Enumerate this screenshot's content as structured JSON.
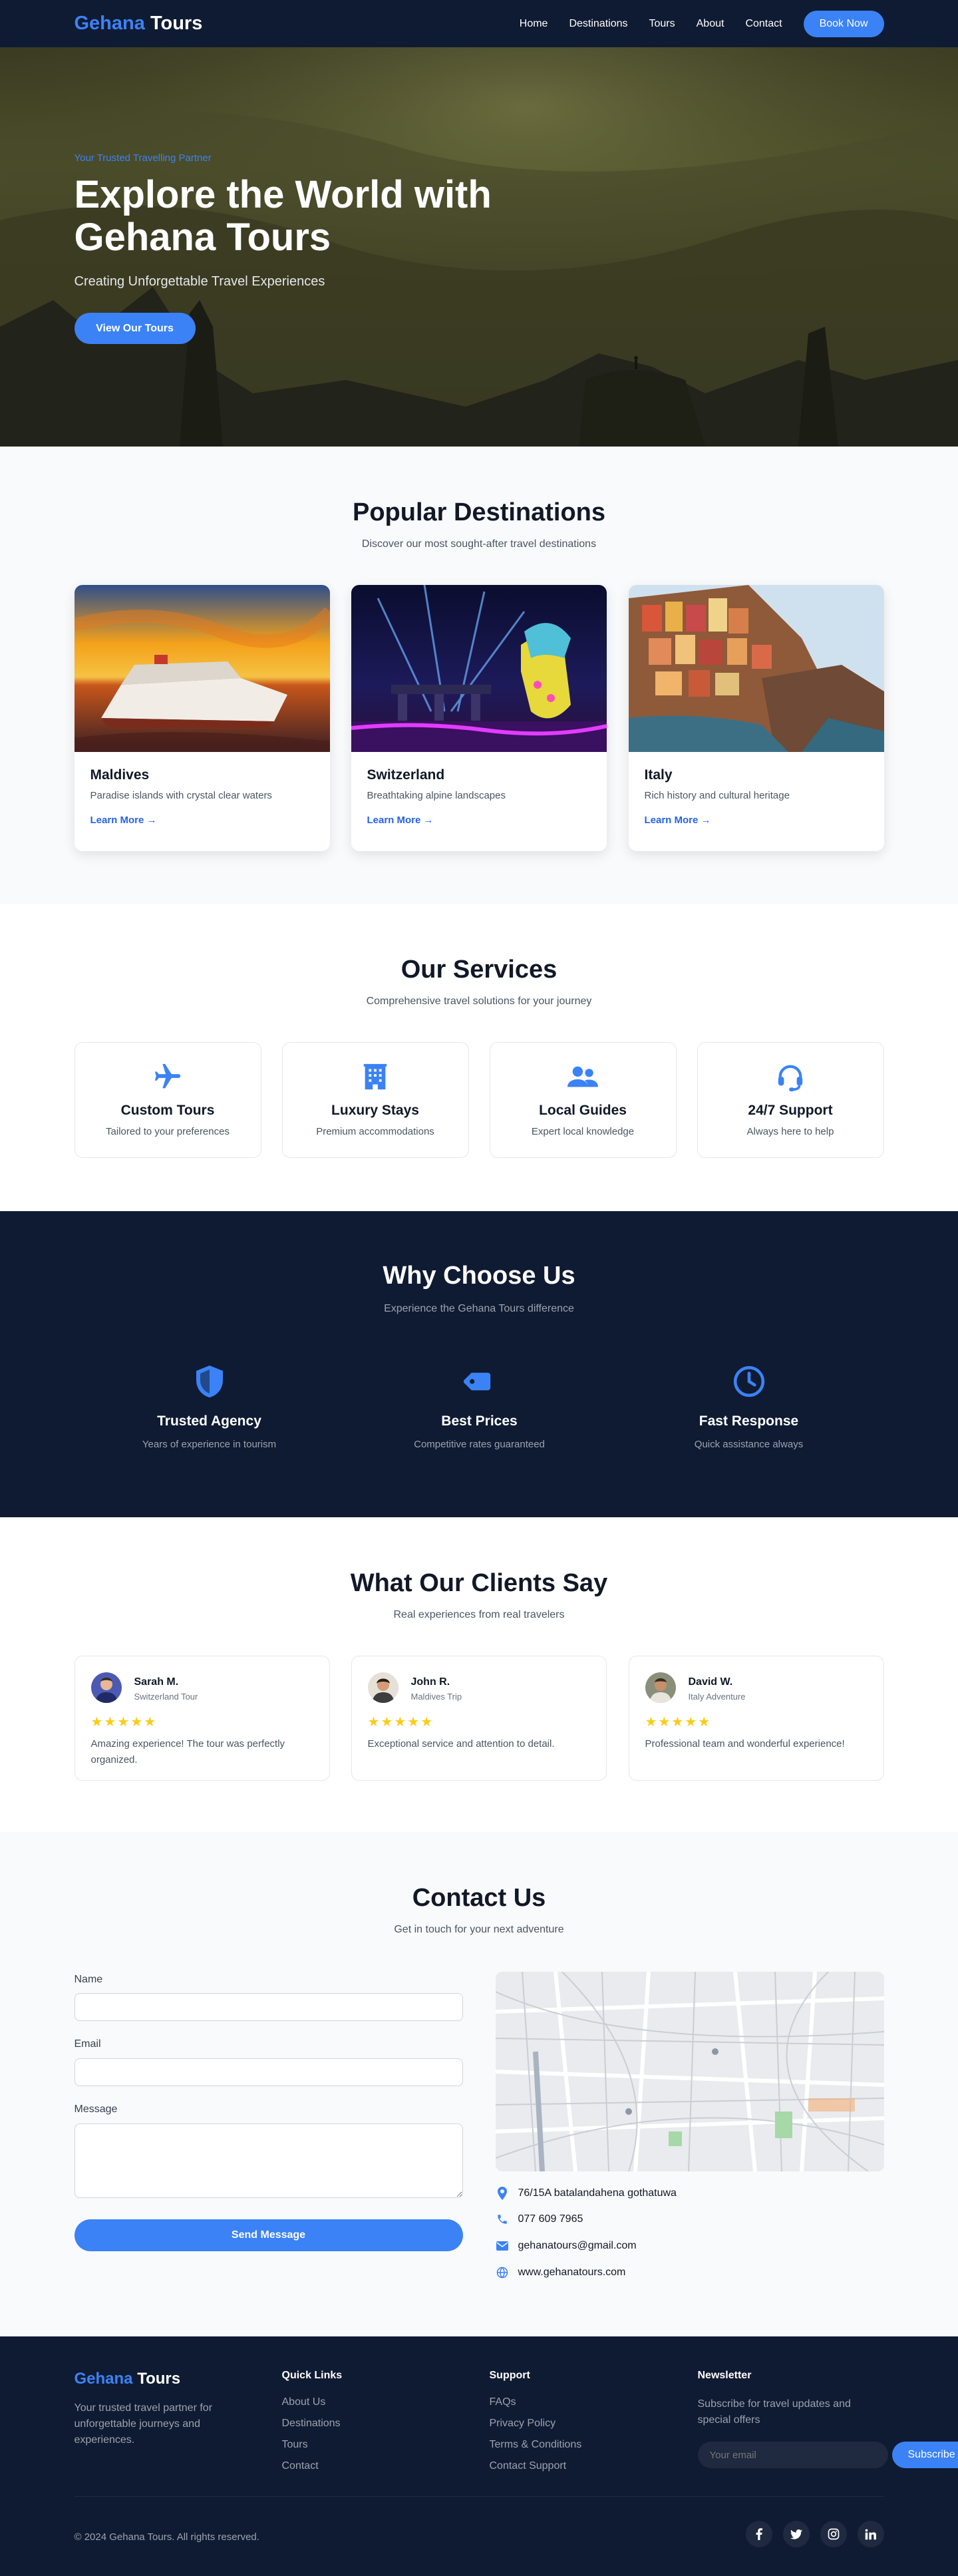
{
  "nav": {
    "logo_a": "Gehana",
    "logo_b": "Tours",
    "links": [
      "Home",
      "Destinations",
      "Tours",
      "About",
      "Contact"
    ],
    "cta": "Book Now"
  },
  "hero": {
    "eyebrow": "Your Trusted Travelling Partner",
    "title_line1": "Explore the World with",
    "title_line2": "Gehana Tours",
    "subtitle": "Creating Unforgettable Travel Experiences",
    "cta": "View Our Tours"
  },
  "destinations": {
    "title": "Popular Destinations",
    "subtitle": "Discover our most sought-after travel destinations",
    "items": [
      {
        "name": "Maldives",
        "desc": "Paradise islands with crystal clear waters",
        "link": "Learn More →"
      },
      {
        "name": "Switzerland",
        "desc": "Breathtaking alpine landscapes",
        "link": "Learn More →"
      },
      {
        "name": "Italy",
        "desc": "Rich history and cultural heritage",
        "link": "Learn More →"
      }
    ]
  },
  "services": {
    "title": "Our Services",
    "subtitle": "Comprehensive travel solutions for your journey",
    "items": [
      {
        "icon": "plane-icon",
        "name": "Custom Tours",
        "desc": "Tailored to your preferences"
      },
      {
        "icon": "hotel-icon",
        "name": "Luxury Stays",
        "desc": "Premium accommodations"
      },
      {
        "icon": "users-icon",
        "name": "Local Guides",
        "desc": "Expert local knowledge"
      },
      {
        "icon": "headset-icon",
        "name": "24/7 Support",
        "desc": "Always here to help"
      }
    ]
  },
  "why": {
    "title": "Why Choose Us",
    "subtitle": "Experience the Gehana Tours difference",
    "items": [
      {
        "icon": "shield-icon",
        "name": "Trusted Agency",
        "desc": "Years of experience in tourism"
      },
      {
        "icon": "tag-icon",
        "name": "Best Prices",
        "desc": "Competitive rates guaranteed"
      },
      {
        "icon": "clock-icon",
        "name": "Fast Response",
        "desc": "Quick assistance always"
      }
    ]
  },
  "testimonials": {
    "title": "What Our Clients Say",
    "subtitle": "Real experiences from real travelers",
    "items": [
      {
        "name": "Sarah M.",
        "trip": "Switzerland Tour",
        "rating": 5,
        "stars": "★★★★★",
        "quote": "Amazing experience! The tour was perfectly organized."
      },
      {
        "name": "John R.",
        "trip": "Maldives Trip",
        "rating": 5,
        "stars": "★★★★★",
        "quote": "Exceptional service and attention to detail."
      },
      {
        "name": "David W.",
        "trip": "Italy Adventure",
        "rating": 5,
        "stars": "★★★★★",
        "quote": "Professional team and wonderful experience!"
      }
    ]
  },
  "contact": {
    "title": "Contact Us",
    "subtitle": "Get in touch for your next adventure",
    "name_label": "Name",
    "email_label": "Email",
    "message_label": "Message",
    "name_value": "",
    "email_value": "",
    "message_value": "",
    "send": "Send Message",
    "address": "76/15A batalandahena gothatuwa",
    "phone": "077 609 7965",
    "email": "gehanatours@gmail.com",
    "website": "www.gehanatours.com"
  },
  "footer": {
    "logo_a": "Gehana",
    "logo_b": "Tours",
    "desc": "Your trusted travel partner for unforgettable journeys and experiences.",
    "quick_title": "Quick Links",
    "quick_links": [
      "About Us",
      "Destinations",
      "Tours",
      "Contact"
    ],
    "support_title": "Support",
    "support_links": [
      "FAQs",
      "Privacy Policy",
      "Terms & Conditions",
      "Contact Support"
    ],
    "newsletter_title": "Newsletter",
    "newsletter_desc": "Subscribe for travel updates and special offers",
    "newsletter_placeholder": "Your email",
    "subscribe": "Subscribe",
    "copyright": "© 2024 Gehana Tours. All rights reserved.",
    "socials": [
      "facebook-icon",
      "twitter-icon",
      "instagram-icon",
      "linkedin-icon"
    ]
  },
  "colors": {
    "primary": "#3b82f6",
    "navy": "#0f1b32",
    "star": "#facc15"
  }
}
